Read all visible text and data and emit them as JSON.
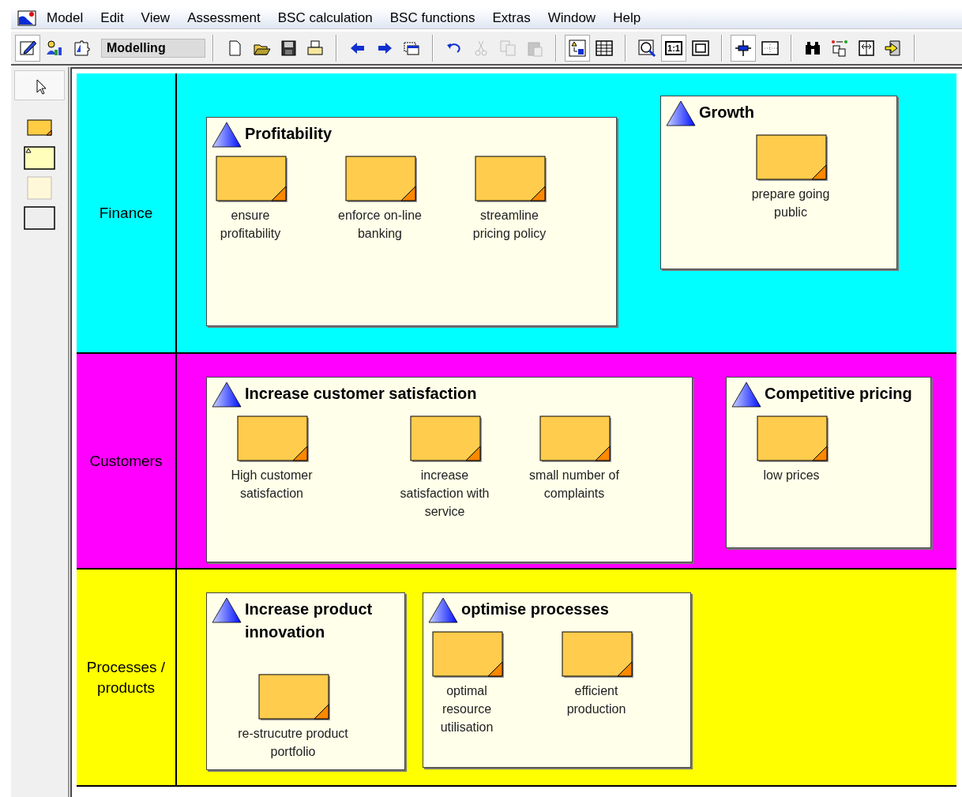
{
  "menu": [
    "Model",
    "Edit",
    "View",
    "Assessment",
    "BSC calculation",
    "BSC functions",
    "Extras",
    "Window",
    "Help"
  ],
  "toolbar": [
    {
      "kind": "edit",
      "pressed": true,
      "disabled": false
    },
    {
      "kind": "people",
      "pressed": false,
      "disabled": false
    },
    {
      "kind": "puzzle",
      "pressed": false,
      "disabled": false
    },
    {
      "kind": "mode",
      "label": "Modelling"
    },
    {
      "kind": "separator"
    },
    {
      "kind": "new",
      "pressed": false,
      "disabled": false
    },
    {
      "kind": "open",
      "pressed": false,
      "disabled": false
    },
    {
      "kind": "save",
      "pressed": false,
      "disabled": false
    },
    {
      "kind": "print",
      "pressed": false,
      "disabled": false
    },
    {
      "kind": "separator"
    },
    {
      "kind": "back",
      "pressed": false,
      "disabled": false
    },
    {
      "kind": "forward",
      "pressed": false,
      "disabled": false
    },
    {
      "kind": "windows",
      "pressed": false,
      "disabled": false
    },
    {
      "kind": "separator"
    },
    {
      "kind": "undo",
      "pressed": false,
      "disabled": false
    },
    {
      "kind": "cut",
      "pressed": false,
      "disabled": true
    },
    {
      "kind": "copy",
      "pressed": false,
      "disabled": true
    },
    {
      "kind": "paste",
      "pressed": false,
      "disabled": true
    },
    {
      "kind": "separator"
    },
    {
      "kind": "layout",
      "pressed": true,
      "disabled": false
    },
    {
      "kind": "table",
      "pressed": false,
      "disabled": false
    },
    {
      "kind": "separator"
    },
    {
      "kind": "zoom",
      "pressed": false,
      "disabled": false
    },
    {
      "kind": "actual",
      "label": "1:1",
      "pressed": true,
      "disabled": false
    },
    {
      "kind": "fit",
      "pressed": false,
      "disabled": false
    },
    {
      "kind": "separator"
    },
    {
      "kind": "cross",
      "pressed": true,
      "disabled": false
    },
    {
      "kind": "grid",
      "pressed": false,
      "disabled": false
    },
    {
      "kind": "separator"
    },
    {
      "kind": "binoculars",
      "pressed": false,
      "disabled": false
    },
    {
      "kind": "swap",
      "pressed": false,
      "disabled": false
    },
    {
      "kind": "split",
      "pressed": false,
      "disabled": false
    },
    {
      "kind": "import",
      "pressed": false,
      "disabled": false
    },
    {
      "kind": "separator"
    }
  ],
  "palette": [
    {
      "kind": "pointer",
      "selected": true
    },
    {
      "kind": "note",
      "selected": false
    },
    {
      "kind": "group",
      "selected": false
    },
    {
      "kind": "plain",
      "selected": false
    },
    {
      "kind": "frame",
      "selected": false
    }
  ],
  "lanes": [
    {
      "label": "Finance",
      "color": "#00ffff",
      "groups": [
        {
          "title": "Profitability",
          "objectives": [
            "ensure profitability",
            "enforce on-line banking",
            "streamline pricing policy"
          ]
        },
        {
          "title": "Growth",
          "objectives": [
            "prepare going public"
          ]
        }
      ]
    },
    {
      "label": "Customers",
      "color": "#ff00ff",
      "groups": [
        {
          "title": "Increase customer satisfaction",
          "objectives": [
            "High customer satisfaction",
            "increase satisfaction with service",
            "small number of complaints"
          ]
        },
        {
          "title": "Competitive pricing",
          "objectives": [
            "low prices"
          ]
        }
      ]
    },
    {
      "label": "Processes / products",
      "color": "#ffff00",
      "groups": [
        {
          "title": "Increase product innovation",
          "objectives": [
            "re-strucutre product portfolio"
          ]
        },
        {
          "title": "optimise processes",
          "objectives": [
            "optimal resource utilisation",
            "efficient production"
          ]
        }
      ]
    }
  ]
}
